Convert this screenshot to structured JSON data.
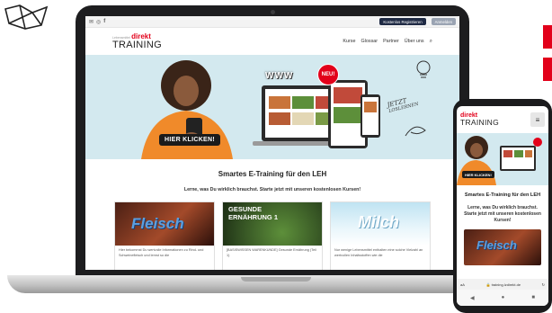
{
  "topbar": {
    "icons": [
      "mail-icon",
      "instagram-icon",
      "facebook-icon"
    ],
    "register_label": "Kostenlos Registrieren",
    "login_label": "Anmelden"
  },
  "brand": {
    "logo_top": "direkt",
    "logo_bottom": "TRAINING",
    "accent": "#e2001a"
  },
  "nav": {
    "items": [
      "Kurse",
      "Glossar",
      "Partner",
      "Über uns"
    ]
  },
  "hero": {
    "cta_label": "HIER KLICKEN!",
    "badge": "NEU!",
    "www": "WWW",
    "jetzt": "JETZT",
    "losslernen": "LOSLERNEN"
  },
  "main": {
    "headline": "Smartes E-Training für den LEH",
    "subline": "Lerne, was Du wirklich brauchst. Starte jetzt mit unseren kostenlosen Kursen!"
  },
  "cards": [
    {
      "title": "Fleisch",
      "text": "Hier bekommst Du wertvolle Informationen zu Rind- und Schweinefleisch und lernst so die"
    },
    {
      "title": "GESUNDE ERNÄHRUNG 1",
      "text": "[BASISWISSEN WARENKUNDE] Gesunde Ernährung (Teil 1)"
    },
    {
      "title": "Milch",
      "text": "Nur wenige Lebensmittel enthalten eine solche Vielzahl an wertvollen Inhaltsstoffen wie die"
    }
  ],
  "phone": {
    "headline": "Smartes E-Training für den LEH",
    "subline": "Lerne, was Du wirklich brauchst. Starte jetzt mit unseren kostenlosen Kursen!",
    "cta_label": "HIER KLICKEN!",
    "card_title": "Fleisch",
    "url_prefix": "aA",
    "url": "training.lzdirekt.de"
  }
}
